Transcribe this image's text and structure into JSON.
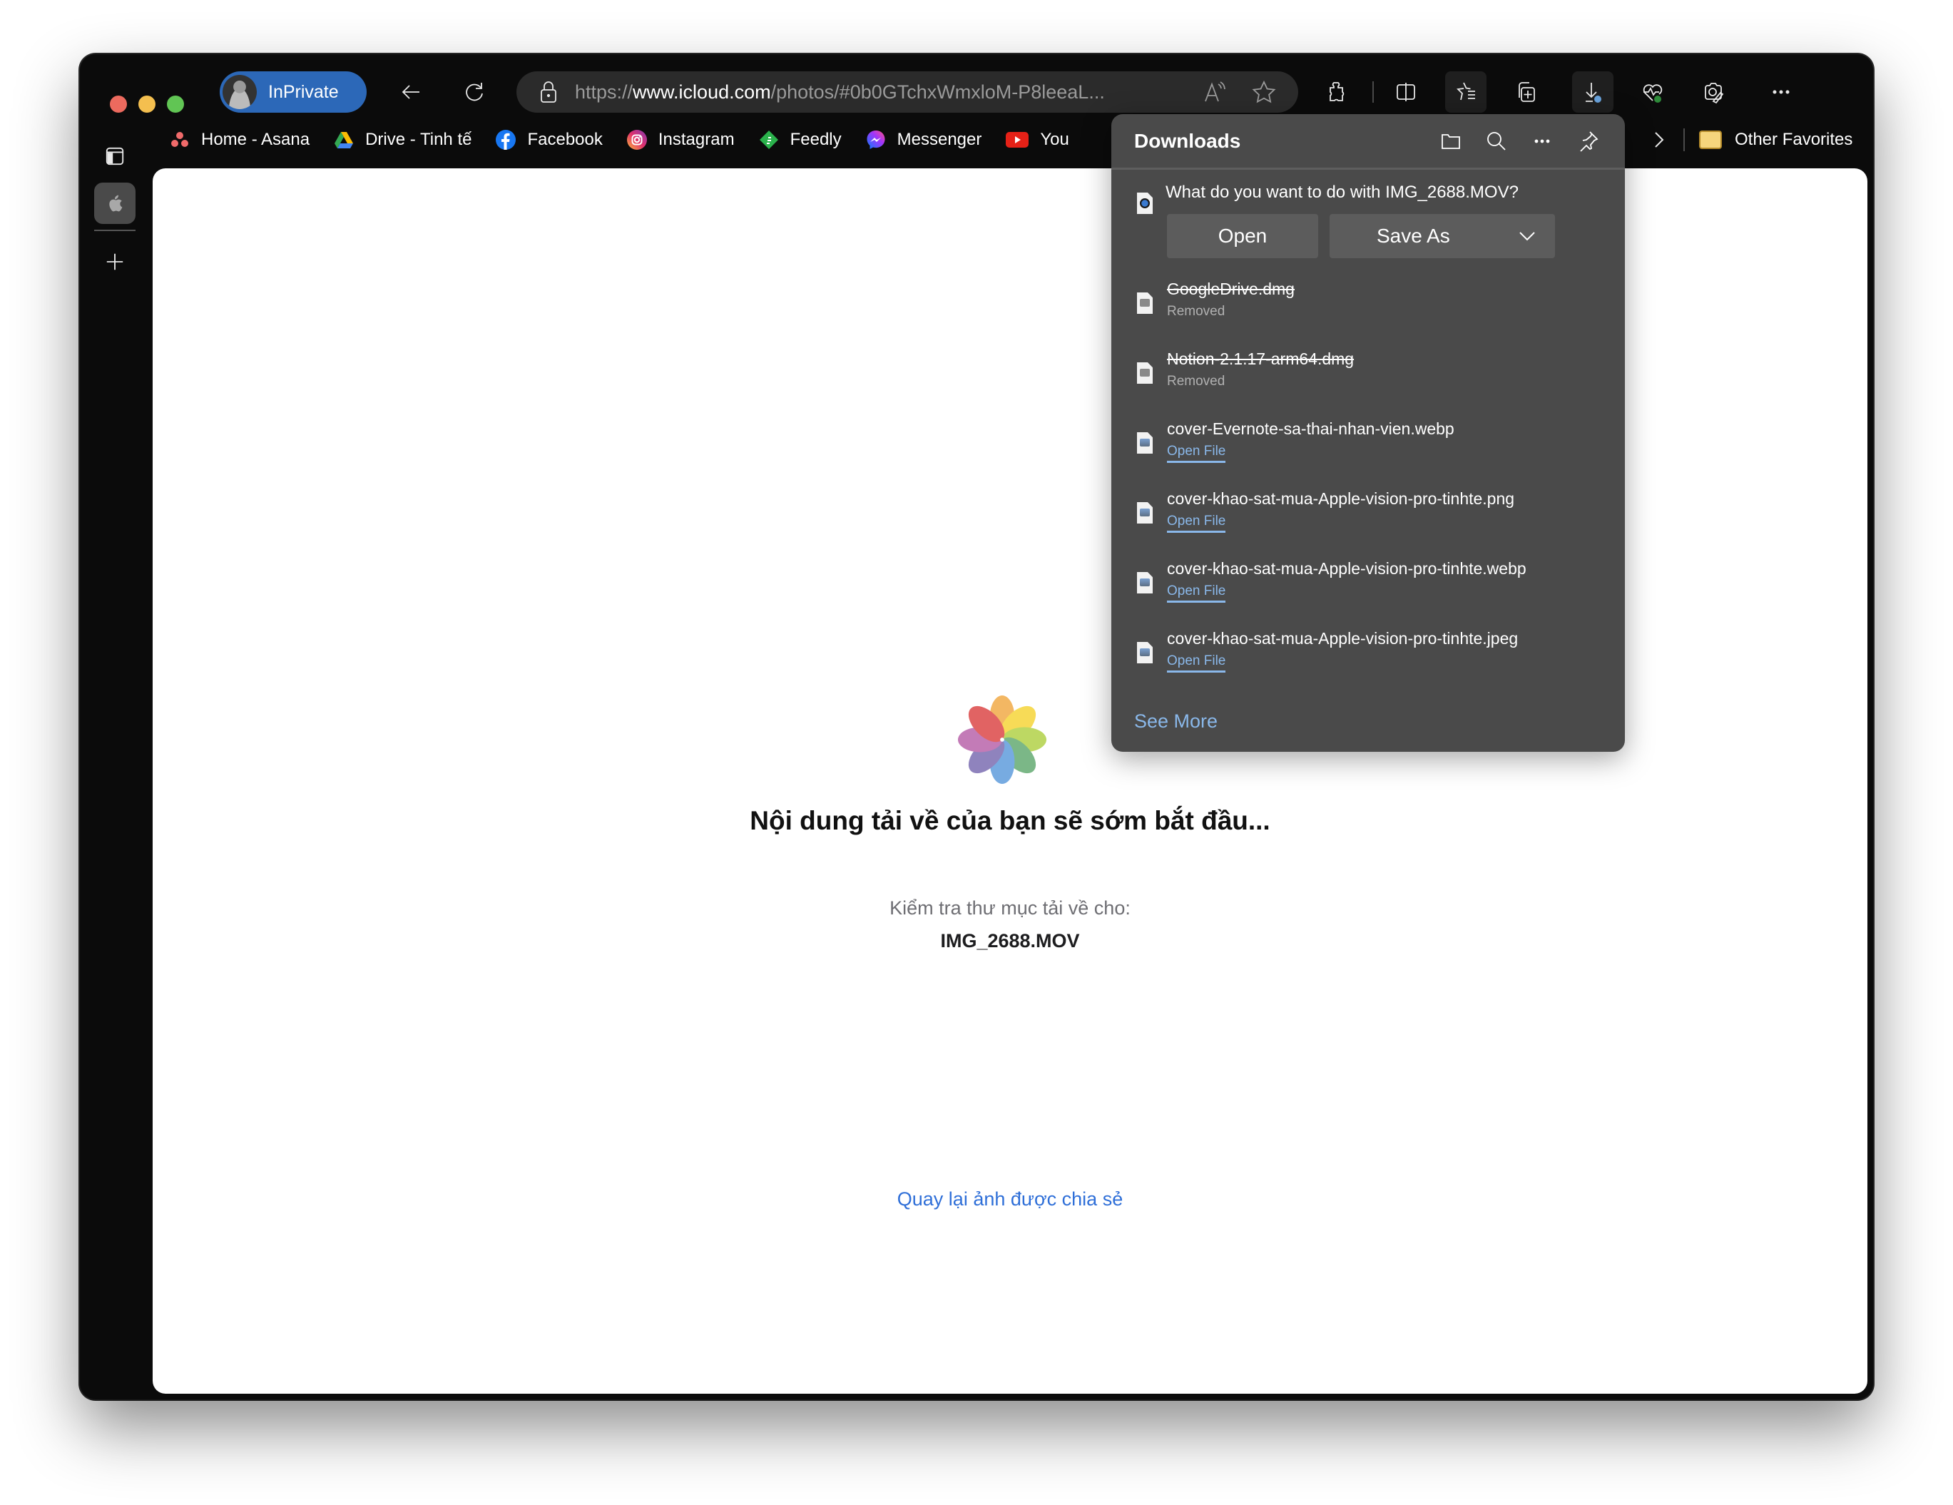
{
  "browser": {
    "profile_label": "InPrivate",
    "address": {
      "scheme": "https://",
      "host": "www.icloud.com",
      "path": "/photos/#0b0GTchxWmxloM-P8leeaL..."
    },
    "toolbar_icons": [
      "back-icon",
      "refresh-icon",
      "read-aloud-icon",
      "favorite-star-icon",
      "extensions-icon",
      "split-screen-icon",
      "favorites-icon",
      "collections-icon",
      "downloads-icon",
      "browser-essentials-icon",
      "edge-drop-icon",
      "more-icon"
    ],
    "bookmarks": [
      {
        "label": "Home - Asana",
        "icon": "asana-icon",
        "color": "#f06a6a"
      },
      {
        "label": "Drive - Tinh tế",
        "icon": "google-drive-icon",
        "color": "#34a853"
      },
      {
        "label": "Facebook",
        "icon": "facebook-icon",
        "color": "#1877f2"
      },
      {
        "label": "Instagram",
        "icon": "instagram-icon",
        "color": "#e1306c"
      },
      {
        "label": "Feedly",
        "icon": "feedly-icon",
        "color": "#2bb24c"
      },
      {
        "label": "Messenger",
        "icon": "messenger-icon",
        "color": "#a334fa"
      },
      {
        "label": "You",
        "icon": "youtube-icon",
        "color": "#ff0000"
      }
    ],
    "other_favorites": "Other Favorites"
  },
  "downloads_panel": {
    "title": "Downloads",
    "prompt": {
      "question": "What do you want to do with IMG_2688.MOV?",
      "open_label": "Open",
      "save_as_label": "Save As"
    },
    "items": [
      {
        "name": "GoogleDrive.dmg",
        "status": "Removed",
        "removed": true,
        "type": "dmg"
      },
      {
        "name": "Notion-2.1.17-arm64.dmg",
        "status": "Removed",
        "removed": true,
        "type": "dmg"
      },
      {
        "name": "cover-Evernote-sa-thai-nhan-vien.webp",
        "status": "Open File",
        "removed": false,
        "type": "img"
      },
      {
        "name": "cover-khao-sat-mua-Apple-vision-pro-tinhte.png",
        "status": "Open File",
        "removed": false,
        "type": "img"
      },
      {
        "name": "cover-khao-sat-mua-Apple-vision-pro-tinhte.webp",
        "status": "Open File",
        "removed": false,
        "type": "img"
      },
      {
        "name": "cover-khao-sat-mua-Apple-vision-pro-tinhte.jpeg",
        "status": "Open File",
        "removed": false,
        "type": "img"
      }
    ],
    "see_more": "See More"
  },
  "page": {
    "heading": "Nội dung tải về của bạn sẽ sớm bắt đầu...",
    "check_label": "Kiểm tra thư mục tải về cho:",
    "filename": "IMG_2688.MOV",
    "back_link": "Quay lại ảnh được chia sẻ"
  },
  "colors": {
    "accent": "#2c68b8",
    "link": "#2f6fd8",
    "panel_link": "#8ab8ea"
  }
}
